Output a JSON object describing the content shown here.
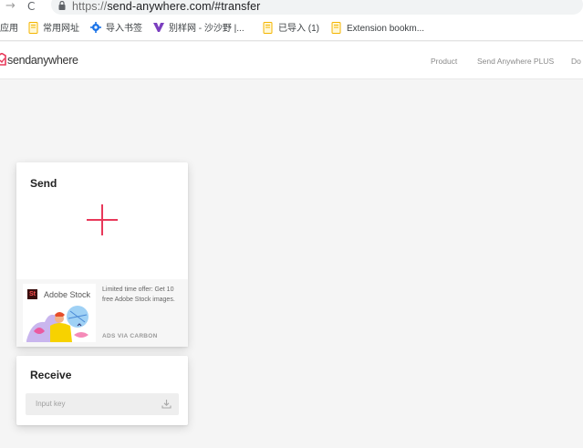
{
  "browser": {
    "url_scheme": "https://",
    "url_rest": "send-anywhere.com/#transfer",
    "back_glyph": "→",
    "reload_glyph": "C",
    "bookmarks": [
      {
        "label": "应用",
        "icon": "apps-icon"
      },
      {
        "label": "常用网址",
        "icon": "folder-icon"
      },
      {
        "label": "导入书签",
        "icon": "gear-icon"
      },
      {
        "label": "别样网 - 沙沙野 |...",
        "icon": "purple-logo-icon"
      },
      {
        "label": "已导入 (1)",
        "icon": "folder-icon"
      },
      {
        "label": "Extension bookm...",
        "icon": "folder-icon"
      }
    ]
  },
  "site": {
    "logo_text": "sendanywhere",
    "nav": [
      "Product",
      "Send Anywhere PLUS",
      "Do"
    ]
  },
  "send": {
    "title": "Send",
    "ad": {
      "brand": "Adobe Stock",
      "logo": "St",
      "text": "Limited time offer: Get 10 free Adobe Stock images.",
      "via": "ADS VIA CARBON"
    }
  },
  "receive": {
    "title": "Receive",
    "placeholder": "Input key"
  },
  "colors": {
    "accent": "#e8385a",
    "folder": "#f4b400"
  }
}
